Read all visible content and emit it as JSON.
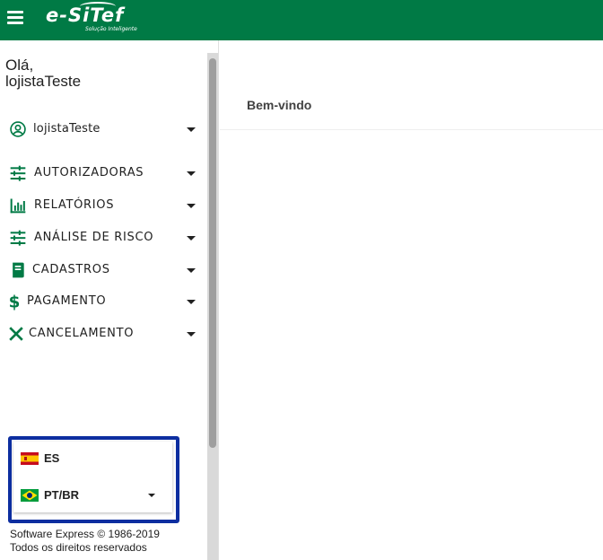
{
  "header": {
    "logo_text": "e-SiTef",
    "logo_tagline": "Solução Inteligente",
    "brand_color": "#007a45",
    "menu_icon": "hamburger-menu-icon"
  },
  "sidebar": {
    "greeting_line1": "Olá,",
    "greeting_line2": "lojistaTeste",
    "user": {
      "label": "lojistaTeste",
      "icon": "account-circle-icon"
    },
    "items": [
      {
        "label": "AUTORIZADORAS",
        "icon": "tune-sliders-icon"
      },
      {
        "label": "RELATÓRIOS",
        "icon": "bar-chart-icon"
      },
      {
        "label": "ANÁLISE DE RISCO",
        "icon": "tune-sliders-icon"
      },
      {
        "label": "CADASTROS",
        "icon": "book-icon"
      },
      {
        "label": "PAGAMENTO",
        "icon": "dollar-sign-icon"
      },
      {
        "label": "CANCELAMENTO",
        "icon": "close-x-icon"
      }
    ],
    "languages": [
      {
        "label": "ES",
        "icon": "spain-flag-icon"
      },
      {
        "label": "PT/BR",
        "icon": "brazil-flag-icon"
      }
    ],
    "footer_line1": "Software Express © 1986-2019",
    "footer_line2": "Todos os direitos reservados",
    "highlight_color": "#0d2ea0"
  },
  "main": {
    "title": "Bem-vindo"
  }
}
